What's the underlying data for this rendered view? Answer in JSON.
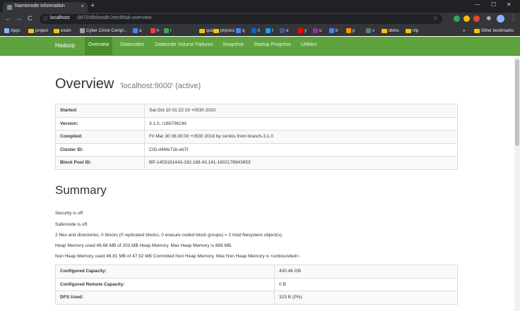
{
  "browser": {
    "tab_title": "Namenode information",
    "tab_close": "×",
    "new_tab": "+",
    "url_host": "localhost",
    "url_path": ":9870/dfshealth.html#tab-overview",
    "back": "←",
    "forward": "→",
    "reload": "C",
    "bookmarks": [
      {
        "label": "Apps",
        "icon": "apps-grid",
        "color": "#8ab4f8"
      },
      {
        "label": "project",
        "icon": "folder",
        "color": "#f4c20d"
      },
      {
        "label": "exam",
        "icon": "folder",
        "color": "#f4c20d"
      },
      {
        "label": "Cyber Crime Compl...",
        "icon": "shield",
        "color": "#9e9e9e"
      },
      {
        "label": "a",
        "icon": "site",
        "color": "#4285f4"
      },
      {
        "label": "h",
        "icon": "site",
        "color": "#ea4335"
      },
      {
        "label": "r",
        "icon": "site",
        "color": "#34a853"
      },
      {
        "label": "quiz",
        "icon": "folder",
        "color": "#f4c20d"
      },
      {
        "label": "physics",
        "icon": "folder",
        "color": "#f4c20d"
      },
      {
        "label": "q",
        "icon": "site",
        "color": "#4285f4"
      },
      {
        "label": "li",
        "icon": "site",
        "color": "#0a66c2"
      },
      {
        "label": "t",
        "icon": "site",
        "color": "#1da1f2"
      },
      {
        "label": "e",
        "icon": "site",
        "color": "#3b5998"
      },
      {
        "label": "y",
        "icon": "site",
        "color": "#ff0000"
      },
      {
        "label": "u",
        "icon": "site",
        "color": "#9c27b0"
      },
      {
        "label": "b",
        "icon": "site",
        "color": "#4285f4"
      },
      {
        "label": "p",
        "icon": "site",
        "color": "#ff9800"
      },
      {
        "label": "x",
        "icon": "site",
        "color": "#607d8b"
      },
      {
        "label": "dbms",
        "icon": "folder",
        "color": "#f4c20d"
      },
      {
        "label": "trip",
        "icon": "folder",
        "color": "#f4c20d"
      }
    ],
    "bookmarks_more": "»",
    "other_bookmarks": "Other bookmarks"
  },
  "navbar": {
    "brand": "Hadoop",
    "items": [
      "Overview",
      "Datanodes",
      "Datanode Volume Failures",
      "Snapshot",
      "Startup Progress",
      "Utilities"
    ],
    "active": "Overview",
    "color": "#5fa33e"
  },
  "overview": {
    "title": "Overview",
    "subtitle": "'localhost:9000' (active)",
    "rows": [
      {
        "key": "Started:",
        "value": "Sat Oct 10 01:22:19 +0530 2020"
      },
      {
        "key": "Version:",
        "value": "3.1.0, r16b70619d"
      },
      {
        "key": "Compiled:",
        "value": "Fri Mar 30 06:30:00 +0530 2018 by centos from branch-3.1.0"
      },
      {
        "key": "Cluster ID:",
        "value": "CID-d46fe71b-eb7f"
      },
      {
        "key": "Block Pool ID:",
        "value": "BP-1403181443-192.168.43.141-1602178943653"
      }
    ]
  },
  "summary": {
    "title": "Summary",
    "lines": [
      "Security is off.",
      "Safemode is off.",
      "2 files and directories, 0 blocks (0 replicated blocks, 0 erasure coded block groups) = 2 total filesystem object(s).",
      "Heap Memory used 46.68 MB of 203 MB Heap Memory. Max Heap Memory is 889 MB.",
      "Non Heap Memory used 46.81 MB of 47.92 MB Commited Non Heap Memory. Max Non Heap Memory is <unbounded>."
    ],
    "rows": [
      {
        "key": "Configured Capacity:",
        "value": "430.46 GB"
      },
      {
        "key": "Configured Remote Capacity:",
        "value": "0 B"
      },
      {
        "key": "DFS Used:",
        "value": "323 B (0%)"
      }
    ]
  }
}
